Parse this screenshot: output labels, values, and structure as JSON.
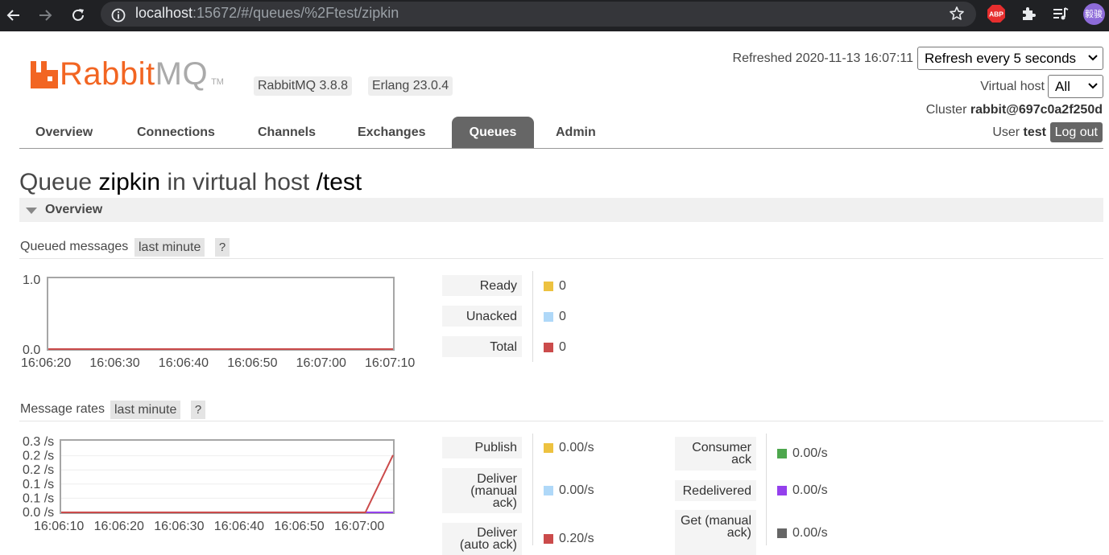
{
  "browser": {
    "url_host": "localhost",
    "url_path": ":15672/#/queues/%2Ftest/zipkin",
    "ext_abp": "ABP",
    "profile": "毅骏"
  },
  "header": {
    "logo_rabbit": "Rabbit",
    "logo_mq": "MQ",
    "logo_tm": "TM",
    "version": "RabbitMQ 3.8.8",
    "erlang": "Erlang 23.0.4",
    "refreshed": "Refreshed 2020-11-13 16:07:11",
    "refresh_select": "Refresh every 5 seconds",
    "vhost_label": "Virtual host",
    "vhost_select": "All",
    "cluster_label": "Cluster",
    "cluster_name": "rabbit@697c0a2f250d",
    "user_label": "User",
    "user_name": "test",
    "logout": "Log out"
  },
  "tabs": [
    {
      "label": "Overview"
    },
    {
      "label": "Connections"
    },
    {
      "label": "Channels"
    },
    {
      "label": "Exchanges"
    },
    {
      "label": "Queues"
    },
    {
      "label": "Admin"
    }
  ],
  "active_tab": "Queues",
  "page": {
    "title_pre": "Queue",
    "queue_name": "zipkin",
    "title_mid": "in virtual host",
    "vhost": "/test",
    "section": "Overview"
  },
  "queued": {
    "title": "Queued messages",
    "range": "last minute",
    "help": "?",
    "stats": [
      {
        "label": "Ready",
        "value": "0",
        "color": "#edc240"
      },
      {
        "label": "Unacked",
        "value": "0",
        "color": "#afd8f8"
      },
      {
        "label": "Total",
        "value": "0",
        "color": "#cb4b4b"
      }
    ]
  },
  "rates": {
    "title": "Message rates",
    "range": "last minute",
    "help": "?",
    "left": [
      {
        "label": "Publish",
        "value": "0.00/s",
        "color": "#edc240"
      },
      {
        "label": "Deliver (manual ack)",
        "value": "0.00/s",
        "color": "#afd8f8"
      },
      {
        "label": "Deliver (auto ack)",
        "value": "0.20/s",
        "color": "#cb4b4b"
      }
    ],
    "right": [
      {
        "label": "Consumer ack",
        "value": "0.00/s",
        "color": "#4da74d"
      },
      {
        "label": "Redelivered",
        "value": "0.00/s",
        "color": "#9440ed"
      },
      {
        "label": "Get (manual ack)",
        "value": "0.00/s",
        "color": "#666666"
      }
    ]
  },
  "chart_data": [
    {
      "type": "line",
      "title": "Queued messages",
      "x": [
        "16:06:20",
        "16:06:30",
        "16:06:40",
        "16:06:50",
        "16:07:00",
        "16:07:10"
      ],
      "ylim": [
        0,
        1.0
      ],
      "y_ticks": [
        "1.0",
        "0.0"
      ],
      "series": [
        {
          "name": "Total",
          "values": [
            0,
            0,
            0,
            0,
            0,
            0
          ],
          "color": "#cb4b4b"
        }
      ]
    },
    {
      "type": "line",
      "title": "Message rates",
      "x": [
        "16:06:10",
        "16:06:20",
        "16:06:30",
        "16:06:40",
        "16:06:50",
        "16:07:00",
        "16:07:05",
        "16:07:10"
      ],
      "ylim": [
        0,
        0.25
      ],
      "x_ticks": [
        "16:06:10",
        "16:06:20",
        "16:06:30",
        "16:06:40",
        "16:06:50",
        "16:07:00"
      ],
      "y_ticks": [
        "0.3 /s",
        "0.2 /s",
        "0.2 /s",
        "0.1 /s",
        "0.1 /s",
        "0.0 /s"
      ],
      "series": [
        {
          "name": "Deliver (auto ack)",
          "values": [
            0,
            0,
            0,
            0,
            0,
            0,
            0,
            0.2
          ],
          "color": "#cb4b4b"
        },
        {
          "name": "Publish",
          "values": [
            0,
            0,
            0,
            0,
            0,
            0,
            0,
            0
          ],
          "color": "#9440ed"
        }
      ]
    }
  ]
}
